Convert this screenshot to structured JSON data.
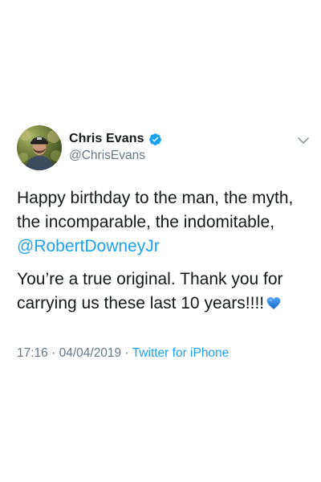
{
  "tweet": {
    "author": {
      "display_name": "Chris Evans",
      "handle": "@ChrisEvans",
      "verified": true,
      "avatar_icon": "profile-photo"
    },
    "body": {
      "paragraph1_text": "Happy birthday to the man, the myth, the incomparable, the indomitable,",
      "paragraph1_mention": "@RobertDowneyJr",
      "paragraph2_text": "You’re a true original. Thank you for carrying us these last 10 years!!!!",
      "paragraph2_emoji": "blue-heart-icon"
    },
    "meta": {
      "time": "17:16",
      "separator": "·",
      "date": "04/04/2019",
      "source": "Twitter for iPhone"
    },
    "menu_icon": "chevron-down-icon"
  },
  "colors": {
    "text": "#14171a",
    "secondary": "#657786",
    "accent": "#1da1f2"
  }
}
